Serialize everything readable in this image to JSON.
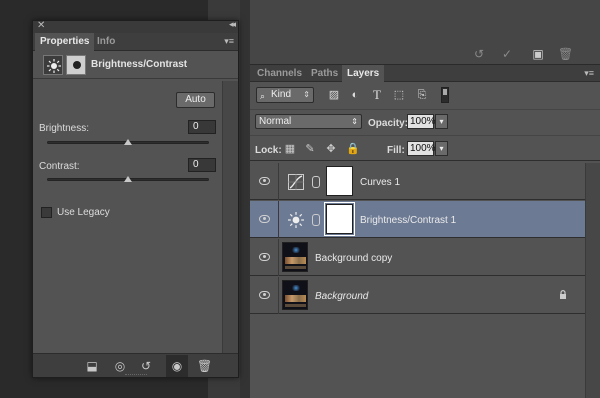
{
  "properties_panel": {
    "tabs": [
      {
        "label": "Properties",
        "active": true
      },
      {
        "label": "Info",
        "active": false
      }
    ],
    "adjustment_title": "Brightness/Contrast",
    "auto_label": "Auto",
    "brightness": {
      "label": "Brightness:",
      "value": "0",
      "slider_fraction": 0.5
    },
    "contrast": {
      "label": "Contrast:",
      "value": "0",
      "slider_fraction": 0.5
    },
    "use_legacy": {
      "label": "Use Legacy",
      "checked": false
    },
    "footer_icons": [
      "clip-to-layer-icon",
      "view-previous-state-icon",
      "reset-icon",
      "visibility-icon",
      "trash-icon"
    ]
  },
  "top_actions": [
    "reset-icon",
    "commit-check-icon",
    "new-layer-icon",
    "trash-icon"
  ],
  "layers_panel": {
    "tabs": [
      {
        "label": "Channels",
        "active": false
      },
      {
        "label": "Paths",
        "active": false
      },
      {
        "label": "Layers",
        "active": true
      }
    ],
    "filter_kind": "Kind",
    "blend_mode": "Normal",
    "opacity_label": "Opacity:",
    "opacity_value": "100%",
    "lock_label": "Lock:",
    "fill_label": "Fill:",
    "fill_value": "100%",
    "layers": [
      {
        "name": "Curves 1",
        "type": "curves-adjustment",
        "visible": true,
        "selected": false
      },
      {
        "name": "Brightness/Contrast 1",
        "type": "brightness-contrast-adjustment",
        "visible": true,
        "selected": true
      },
      {
        "name": "Background copy",
        "type": "image",
        "visible": true,
        "selected": false
      },
      {
        "name": "Background",
        "type": "image",
        "visible": true,
        "selected": false,
        "locked": true,
        "italic": true
      }
    ]
  },
  "colors": {
    "selected_row": "#6c7a94",
    "panel_bg": "#535353"
  }
}
